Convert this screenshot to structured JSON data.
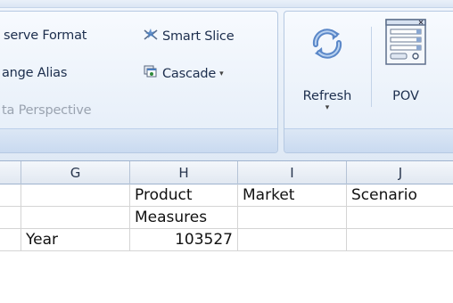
{
  "ribbon": {
    "left_group": {
      "col1": [
        {
          "label": "serve Format",
          "state": "enabled"
        },
        {
          "label": "ange Alias",
          "state": "enabled"
        },
        {
          "label": "ta Perspective",
          "state": "disabled"
        }
      ],
      "col2": [
        {
          "label": "Smart Slice",
          "icon": "smart-slice-icon"
        },
        {
          "label": "Cascade",
          "icon": "cascade-icon",
          "caret": "▾"
        }
      ]
    },
    "refresh": {
      "label": "Refresh",
      "caret": "▾",
      "icon": "refresh-icon"
    },
    "pov": {
      "label": "POV",
      "icon": "pov-icon"
    }
  },
  "sheet": {
    "columns": [
      "G",
      "H",
      "I",
      "J"
    ],
    "rows": [
      [
        "",
        "Product",
        "Market",
        "Scenario"
      ],
      [
        "",
        "Measures",
        "",
        ""
      ],
      [
        "Year",
        "103527",
        "",
        ""
      ]
    ]
  },
  "colors": {
    "ribbon_text": "#1c2e4d",
    "disabled_text": "#9aa3b0",
    "grid_line": "#d4d4d4"
  }
}
